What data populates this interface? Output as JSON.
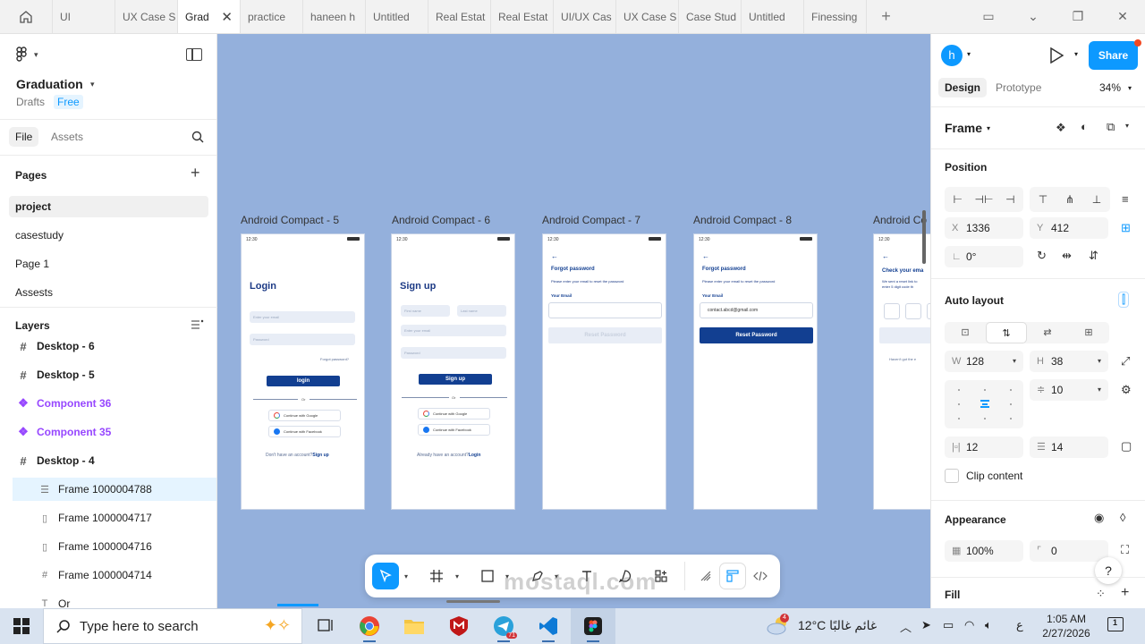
{
  "browser_tabs": [
    {
      "label": "UI"
    },
    {
      "label": "UX Case S"
    },
    {
      "label": "Grad",
      "active": true
    },
    {
      "label": "practice"
    },
    {
      "label": "haneen h"
    },
    {
      "label": "Untitled"
    },
    {
      "label": "Real Estat"
    },
    {
      "label": "Real Estat"
    },
    {
      "label": "UI/UX Cas"
    },
    {
      "label": "UX Case S"
    },
    {
      "label": "Case Stud"
    },
    {
      "label": "Untitled"
    },
    {
      "label": "Finessing"
    }
  ],
  "close_glyph": "✕",
  "plus_glyph": "+",
  "left_panel": {
    "project_title": "Graduation",
    "drafts": "Drafts",
    "plan": "Free",
    "tabs": {
      "file": "File",
      "assets": "Assets"
    },
    "pages_heading": "Pages",
    "pages": [
      {
        "label": "project",
        "selected": true
      },
      {
        "label": "casestudy"
      },
      {
        "label": "Page 1"
      },
      {
        "label": "Assests"
      }
    ],
    "layers_heading": "Layers",
    "layers": [
      {
        "label": "Desktop - 6",
        "icon": "#",
        "type": "frame"
      },
      {
        "label": "Desktop - 5",
        "icon": "#",
        "type": "frame"
      },
      {
        "label": "Component 36",
        "icon": "❖",
        "type": "component"
      },
      {
        "label": "Component 35",
        "icon": "❖",
        "type": "component"
      },
      {
        "label": "Desktop - 4",
        "icon": "#",
        "type": "frame"
      },
      {
        "label": "Frame 1000004788",
        "icon": "☰",
        "type": "child",
        "selected": true
      },
      {
        "label": "Frame 1000004717",
        "icon": "▯",
        "type": "child"
      },
      {
        "label": "Frame 1000004716",
        "icon": "▯",
        "type": "child"
      },
      {
        "label": "Frame 1000004714",
        "icon": "#",
        "type": "child"
      },
      {
        "label": "Or",
        "icon": "T",
        "type": "child"
      }
    ]
  },
  "canvas": {
    "frames": [
      {
        "label": "Android Compact - 5"
      },
      {
        "label": "Android Compact - 6"
      },
      {
        "label": "Android Compact - 7"
      },
      {
        "label": "Android Compact - 8"
      },
      {
        "label": "Android Co"
      }
    ],
    "status_time": "12:30",
    "login": {
      "title": "Login",
      "email_placeholder": "Enter your email",
      "password_placeholder": "Password",
      "forgot": "Forgot password?",
      "button": "login",
      "or": "Or",
      "google": "Continue with Google",
      "facebook": "Continue with Facebook",
      "footer": "Don't have an account?",
      "footer_link": "Sign up"
    },
    "signup": {
      "title": "Sign up",
      "first_name": "First name",
      "last_name": "Last name",
      "email_placeholder": "Enter your email",
      "password_placeholder": "Password",
      "button": "Sign up",
      "or": "Or",
      "google": "Continue with Google",
      "facebook": "Continue with Facebook",
      "footer": "Already have an account?",
      "footer_link": "Login"
    },
    "forgot7": {
      "back": "←",
      "title": "Forgot password",
      "desc": "Please enter your email to reset the password",
      "label": "Your Email",
      "button": "Reset Password"
    },
    "forgot8": {
      "back": "←",
      "title": "Forgot password",
      "desc": "Please enter your email to reset the password",
      "label": "Your Email",
      "value": "contact.abcd@gmail.com",
      "button": "Reset Password"
    },
    "check_email": {
      "back": "←",
      "title": "Check your ema",
      "desc1": "We sent a reset link to",
      "desc2": "enter 5 digit code th",
      "resend": "Haven't got the e"
    }
  },
  "right_panel": {
    "avatar_letter": "h",
    "share": "Share",
    "tabs": {
      "design": "Design",
      "prototype": "Prototype"
    },
    "zoom": "34%",
    "frame_heading": "Frame",
    "position_heading": "Position",
    "x_label": "X",
    "x_value": "1336",
    "y_label": "Y",
    "y_value": "412",
    "rotation_value": "0°",
    "auto_layout_heading": "Auto layout",
    "w_label": "W",
    "w_value": "128",
    "h_label": "H",
    "h_value": "38",
    "gap_value": "10",
    "padding_h": "12",
    "padding_v": "14",
    "clip_content": "Clip content",
    "appearance_heading": "Appearance",
    "opacity": "100%",
    "radius": "0",
    "fill_heading": "Fill",
    "help": "?"
  },
  "taskbar": {
    "search_placeholder": "Type here to search",
    "telegram_badge": "71",
    "weather_badge": "4",
    "temperature": "12°C",
    "weather_text": "غائم غالبًا",
    "lang": "ع",
    "time": "1:05 AM",
    "date": "2/27/2026",
    "notification_count": "1"
  },
  "watermark": "mostaql.com",
  "colors": {
    "accent": "#0d99ff",
    "canvas_bg": "#94b0dc",
    "brand_navy": "#123f91",
    "component_purple": "#9747ff"
  }
}
